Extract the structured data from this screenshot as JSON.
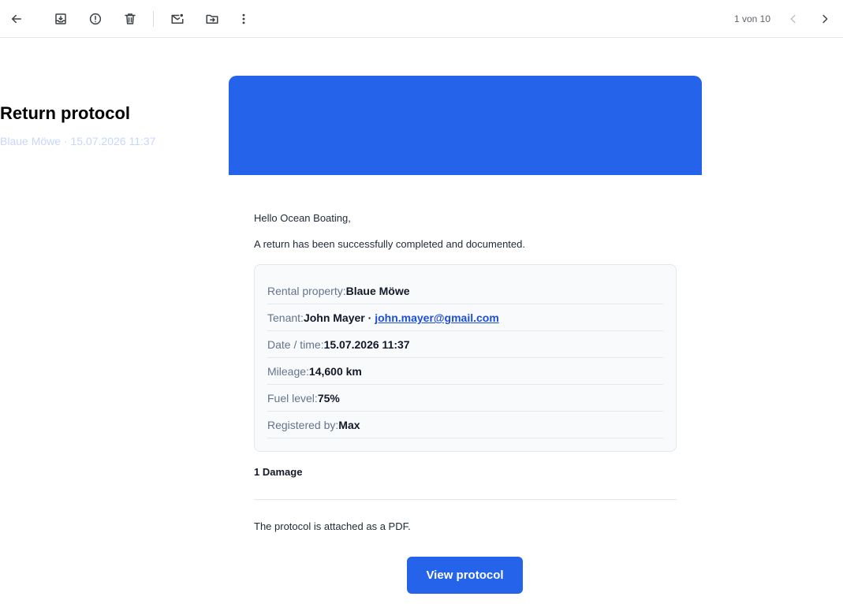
{
  "toolbar": {
    "icons": [
      "back-arrow-icon",
      "archive-icon",
      "report-spam-icon",
      "delete-icon",
      "mark-unread-icon",
      "move-to-icon",
      "more-vert-icon",
      "chevron-left-icon",
      "chevron-right-icon"
    ],
    "pager_text": "1 von 10"
  },
  "email": {
    "header": {
      "title": "Return protocol",
      "subtitle": "Blaue Möwe · 15.07.2026 11:37",
      "color": "#2563eb"
    },
    "greeting": "Hello Ocean Boating,",
    "intro": "A return has been successfully completed and documented.",
    "details": {
      "rental_label": "Rental property:",
      "rental_value": "Blaue Möwe",
      "tenant_label": "Tenant:",
      "tenant_name": "John Mayer",
      "tenant_sep": " · ",
      "tenant_email": "john.mayer@gmail.com",
      "datetime_label": "Date / time:",
      "datetime_value": "15.07.2026 11:37",
      "mileage_label": "Mileage:",
      "mileage_value": "14,600 km",
      "fuel_label": "Fuel level:",
      "fuel_value": "75%",
      "registered_label": "Registered by:",
      "registered_value": "Max"
    },
    "damage_heading": "1 Damage",
    "attachment_note": "The protocol is attached as a PDF.",
    "cta_label": "View protocol"
  }
}
